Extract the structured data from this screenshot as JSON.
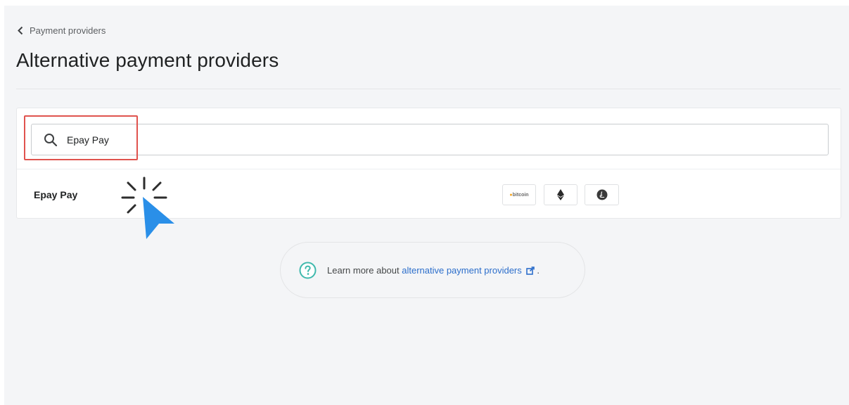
{
  "breadcrumb": {
    "label": "Payment providers",
    "icon": "chevron-left-icon"
  },
  "page": {
    "title": "Alternative payment providers"
  },
  "search": {
    "value": "Epay Pay",
    "icon": "search-icon"
  },
  "providers": [
    {
      "name": "Epay Pay",
      "payment_icons": [
        {
          "icon": "bitcoin-cash-icon",
          "label": "bitcoin"
        },
        {
          "icon": "ethereum-icon"
        },
        {
          "icon": "litecoin-icon"
        }
      ]
    }
  ],
  "help": {
    "prefix": "Learn more about ",
    "link": "alternative payment providers",
    "suffix": " .",
    "icon": "question-circle-icon",
    "link_icon": "external-link-icon"
  },
  "colors": {
    "accent": "#2c6ecb",
    "highlight": "#e0534e",
    "help_icon": "#3fb9ad",
    "cursor": "#2a8fe8"
  }
}
